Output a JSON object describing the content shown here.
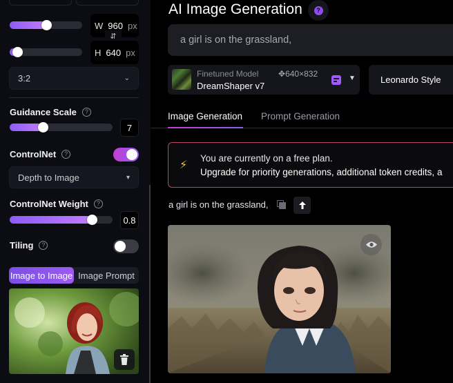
{
  "sidebar": {
    "dimensions": {
      "width": {
        "label": "W",
        "value": "960",
        "unit": "px",
        "slider_fraction": 0.5
      },
      "height": {
        "label": "H",
        "value": "640",
        "unit": "px",
        "slider_fraction": 0.1
      },
      "aspect_ratio": "3:2"
    },
    "guidance_scale": {
      "label": "Guidance Scale",
      "value": "7",
      "slider_fraction": 0.32
    },
    "controlnet": {
      "label": "ControlNet",
      "enabled": true,
      "mode": "Depth to Image"
    },
    "controlnet_weight": {
      "label": "ControlNet Weight",
      "value": "0.8",
      "slider_fraction": 0.8
    },
    "tiling": {
      "label": "Tiling",
      "enabled": false
    },
    "image_tabs": [
      "Image to Image",
      "Image Prompt"
    ]
  },
  "main": {
    "title": "AI Image Generation",
    "prompt": "a girl is on the grassland,",
    "model": {
      "kind": "Finetuned Model",
      "name": "DreamShaper v7",
      "size": "640×832"
    },
    "style": "Leonardo Style",
    "tabs": [
      {
        "label": "Image Generation",
        "active": true
      },
      {
        "label": "Prompt Generation",
        "active": false
      }
    ],
    "plan_banner": {
      "line1": "You are currently on a free plan.",
      "line2": "Upgrade for priority generations, additional token credits, a"
    },
    "generation": {
      "prompt": "a girl is on the grassland,"
    }
  },
  "colors": {
    "accent_purple": "#8f5cf6",
    "accent_pink": "#c33fcf",
    "banner_border": "#b14a6b",
    "bolt": "#f5c542"
  },
  "icons": [
    "help-icon",
    "swap-icon",
    "chevron-down-icon",
    "trash-icon",
    "style-icon",
    "lightning-icon",
    "copy-icon",
    "arrow-up-icon",
    "eye-icon",
    "info-icon"
  ]
}
